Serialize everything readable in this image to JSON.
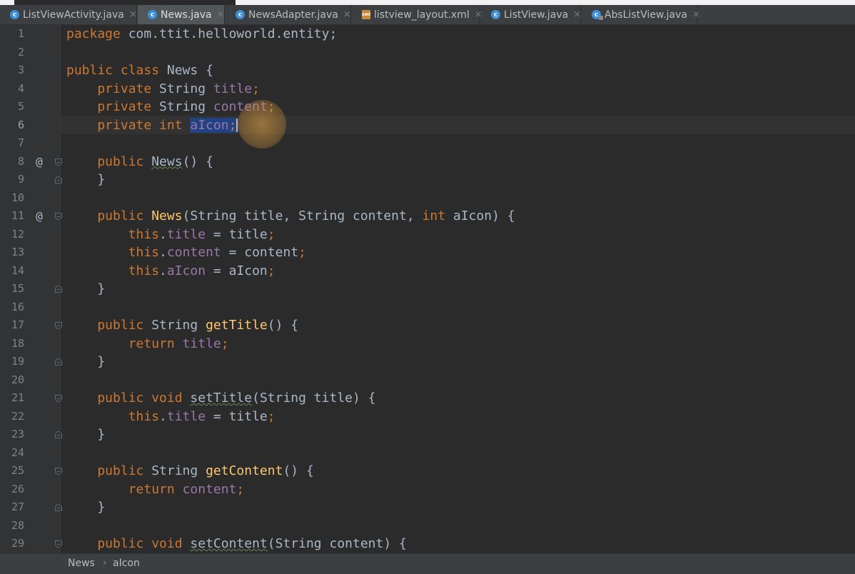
{
  "tabs": [
    {
      "label": "ListViewActivity.java",
      "icon": "class-icon",
      "active": false
    },
    {
      "label": "News.java",
      "icon": "class-icon",
      "active": true
    },
    {
      "label": "NewsAdapter.java",
      "icon": "class-icon",
      "active": false
    },
    {
      "label": "listview_layout.xml",
      "icon": "xml-file-icon",
      "active": false
    },
    {
      "label": "ListView.java",
      "icon": "class-icon",
      "active": false
    },
    {
      "label": "AbsListView.java",
      "icon": "abstract-class-icon",
      "active": false
    }
  ],
  "tab_close_glyph": "×",
  "gutter": {
    "line_numbers": [
      "1",
      "2",
      "3",
      "4",
      "5",
      "6",
      "7",
      "8",
      "9",
      "10",
      "11",
      "12",
      "13",
      "14",
      "15",
      "16",
      "17",
      "18",
      "19",
      "20",
      "21",
      "22",
      "23",
      "24",
      "25",
      "26",
      "27",
      "28",
      "29"
    ],
    "override_markers": [
      "@",
      "@"
    ]
  },
  "code": {
    "l1": [
      "package",
      " com.ttit.helloworld.entity;"
    ],
    "l3": [
      "public class",
      " News {"
    ],
    "l4": [
      "    private",
      " String ",
      "title",
      ";"
    ],
    "l5": [
      "    private",
      " String ",
      "content",
      ";"
    ],
    "l6": [
      "    private int",
      " ",
      "aIcon",
      ";"
    ],
    "l8": [
      "    public",
      " ",
      "News",
      "() {"
    ],
    "l9": [
      "    }"
    ],
    "l11": [
      "    public",
      " ",
      "News",
      "(String title, String content, ",
      "int",
      " aIcon) {"
    ],
    "l12": [
      "        this",
      ".",
      "title",
      " = title",
      ";"
    ],
    "l13": [
      "        this",
      ".",
      "content",
      " = content",
      ";"
    ],
    "l14": [
      "        this",
      ".",
      "aIcon",
      " = aIcon",
      ";"
    ],
    "l15": [
      "    }"
    ],
    "l17": [
      "    public",
      " String ",
      "getTitle",
      "() {"
    ],
    "l18": [
      "        return",
      " ",
      "title",
      ";"
    ],
    "l19": [
      "    }"
    ],
    "l21": [
      "    public void",
      " ",
      "setTitle",
      "(String title) {"
    ],
    "l22": [
      "        this",
      ".",
      "title",
      " = title",
      ";"
    ],
    "l23": [
      "    }"
    ],
    "l25": [
      "    public",
      " String ",
      "getContent",
      "() {"
    ],
    "l26": [
      "        return",
      " ",
      "content",
      ";"
    ],
    "l27": [
      "    }"
    ],
    "l29": [
      "    public void",
      " ",
      "setContent",
      "(String content) {"
    ]
  },
  "breadcrumb": {
    "items": [
      "News",
      "aIcon"
    ],
    "separator": "›"
  },
  "colors": {
    "keyword": "#cc7832",
    "field": "#9876aa",
    "method": "#ffc66d",
    "text": "#a9b7c6",
    "background": "#2b2b2b",
    "selection": "#214283"
  }
}
